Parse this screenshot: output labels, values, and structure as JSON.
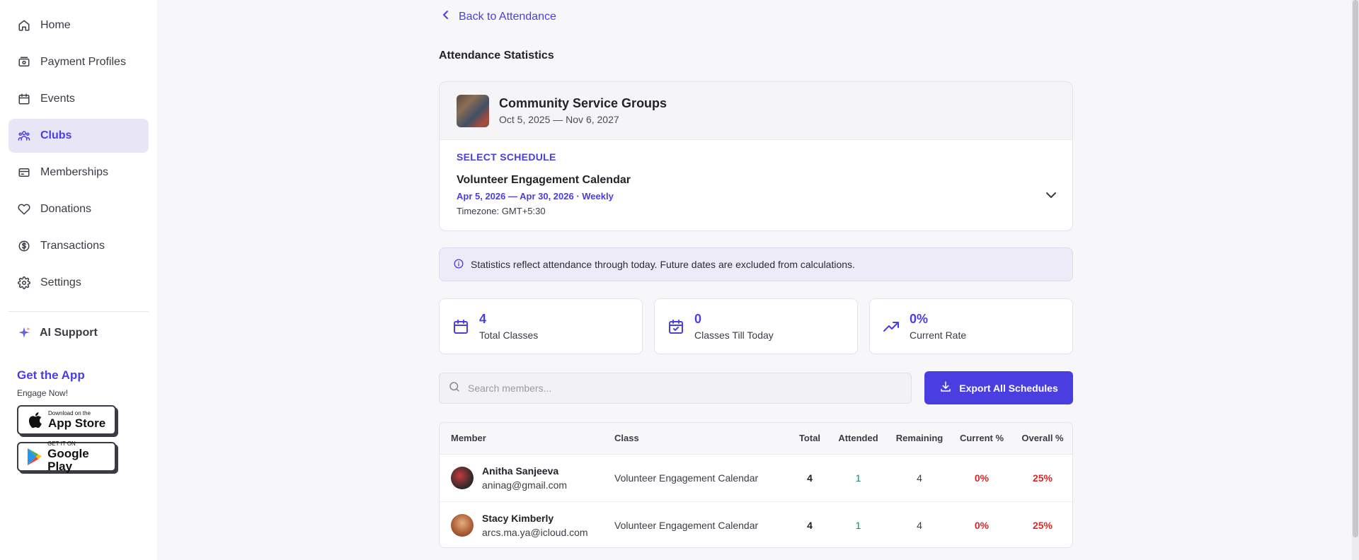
{
  "sidebar": {
    "items": [
      {
        "label": "Home",
        "icon": "home-icon"
      },
      {
        "label": "Payment Profiles",
        "icon": "wallet-icon"
      },
      {
        "label": "Events",
        "icon": "calendar-icon"
      },
      {
        "label": "Clubs",
        "icon": "users-icon",
        "active": true
      },
      {
        "label": "Memberships",
        "icon": "card-icon"
      },
      {
        "label": "Donations",
        "icon": "heart-icon"
      },
      {
        "label": "Transactions",
        "icon": "dollar-icon"
      },
      {
        "label": "Settings",
        "icon": "gear-icon"
      }
    ],
    "ai_support": "AI Support",
    "get_app": {
      "title": "Get the App",
      "subtitle": "Engage Now!",
      "app_store": {
        "small": "Download on the",
        "big": "App Store"
      },
      "google_play": {
        "small": "GET IT ON",
        "big": "Google Play"
      }
    }
  },
  "main": {
    "back_link": "Back to Attendance",
    "title": "Attendance Statistics",
    "group": {
      "name": "Community Service Groups",
      "dates": "Oct 5, 2025 — Nov 6, 2027"
    },
    "schedule": {
      "label": "SELECT SCHEDULE",
      "name": "Volunteer Engagement Calendar",
      "range": "Apr 5, 2026 — Apr 30, 2026 · Weekly",
      "timezone": "Timezone: GMT+5:30"
    },
    "info": "Statistics reflect attendance through today. Future dates are excluded from calculations.",
    "stats": [
      {
        "value": "4",
        "label": "Total Classes",
        "icon": "calendar-icon"
      },
      {
        "value": "0",
        "label": "Classes Till Today",
        "icon": "calendar-check-icon"
      },
      {
        "value": "0%",
        "label": "Current Rate",
        "icon": "trending-up-icon"
      }
    ],
    "search": {
      "placeholder": "Search members...",
      "value": ""
    },
    "export_label": "Export All Schedules",
    "table": {
      "headers": [
        "Member",
        "Class",
        "Total",
        "Attended",
        "Remaining",
        "Current %",
        "Overall %"
      ],
      "rows": [
        {
          "name": "Anitha Sanjeeva",
          "email": "aninag@gmail.com",
          "class": "Volunteer Engagement Calendar",
          "total": "4",
          "attended": "1",
          "remaining": "4",
          "current": "0%",
          "overall": "25%"
        },
        {
          "name": "Stacy Kimberly",
          "email": "arcs.ma.ya@icloud.com",
          "class": "Volunteer Engagement Calendar",
          "total": "4",
          "attended": "1",
          "remaining": "4",
          "current": "0%",
          "overall": "25%"
        }
      ]
    }
  },
  "colors": {
    "accent": "#4a3ee0",
    "danger": "#d62828",
    "success": "#1a8a5a"
  }
}
